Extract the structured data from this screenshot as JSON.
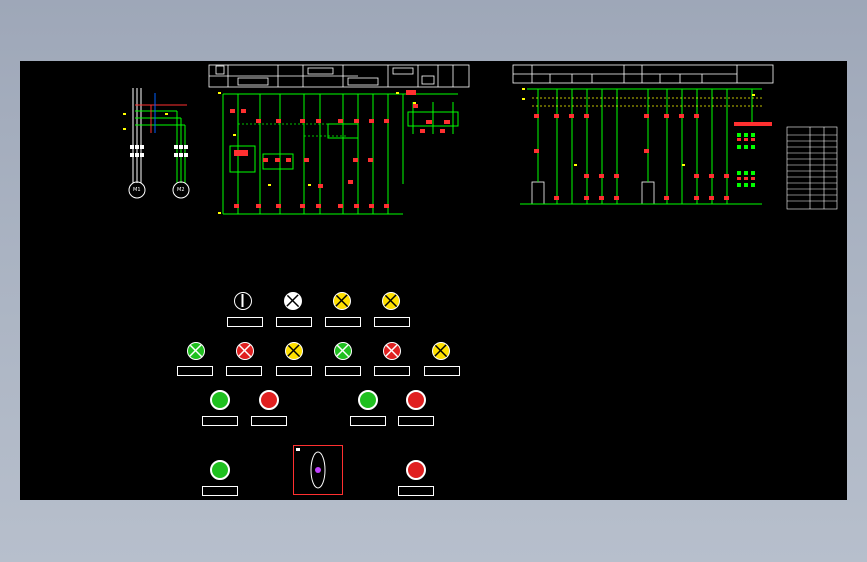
{
  "colors": {
    "background": "#000000",
    "wire": "#00ff00",
    "frame": "#ffffff",
    "device": "#ff3030",
    "mark": "#ffff00",
    "lamp_green": "#20c020",
    "lamp_red": "#e02020",
    "lamp_yellow": "#ffe000",
    "lamp_white": "#ffffff"
  },
  "lamps_row1": [
    {
      "icon": "selector-icon",
      "label": "",
      "color": "white"
    },
    {
      "icon": "lamp-white-icon",
      "label": "",
      "color": "white"
    },
    {
      "icon": "lamp-yellow-icon",
      "label": "",
      "color": "yellow"
    },
    {
      "icon": "lamp-yellow-icon",
      "label": "",
      "color": "yellow"
    }
  ],
  "lamps_row2": [
    {
      "icon": "lamp-green-icon",
      "label": "",
      "color": "green"
    },
    {
      "icon": "lamp-red-icon",
      "label": "",
      "color": "red"
    },
    {
      "icon": "lamp-yellow-icon",
      "label": "",
      "color": "yellow"
    },
    {
      "icon": "lamp-green-icon",
      "label": "",
      "color": "green"
    },
    {
      "icon": "lamp-red-icon",
      "label": "",
      "color": "red"
    },
    {
      "icon": "lamp-yellow-icon",
      "label": "",
      "color": "yellow"
    }
  ],
  "buttons_row3": [
    {
      "icon": "button-green-icon",
      "label": ""
    },
    {
      "icon": "button-red-icon",
      "label": ""
    },
    {
      "icon": "button-green-icon",
      "label": ""
    },
    {
      "icon": "button-red-icon",
      "label": ""
    }
  ],
  "buttons_row4": [
    {
      "icon": "button-green-icon",
      "label": ""
    },
    {
      "icon": "button-red-icon",
      "label": ""
    }
  ],
  "motors": [
    {
      "label": "M1"
    },
    {
      "label": "M2"
    }
  ],
  "notes": {
    "left_note": "",
    "middle_note": ""
  },
  "icons": {
    "knob": "joystick-icon"
  }
}
